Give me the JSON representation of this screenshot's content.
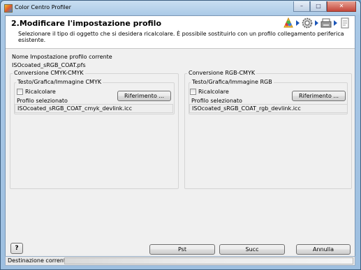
{
  "window": {
    "title": "Color Centro Profiler"
  },
  "header": {
    "title": "2.Modificare l'impostazione profilo",
    "subtitle": "Selezionare il tipo di oggetto che si desidera ricalcolare. È possibile sostituirlo con un profilo collegamento periferica esistente."
  },
  "current": {
    "label": "Nome Impostazione profilo corrente",
    "value": "ISOcoated_sRGB_COAT.pfs"
  },
  "cmyk": {
    "group_title": "Conversione CMYK-CMYK",
    "sub_title": "Testo/Grafica/Immagine CMYK",
    "recalc_label": "Ricalcolare",
    "reference_button": "Riferimento ...",
    "profile_label": "Profilo selezionato",
    "profile_value": "ISOcoated_sRGB_COAT_cmyk_devlink.icc"
  },
  "rgb": {
    "group_title": "Conversione RGB-CMYK",
    "sub_title": "Testo/Grafica/Immagine RGB",
    "recalc_label": "Ricalcolare",
    "reference_button": "Riferimento ...",
    "profile_label": "Profilo selezionato",
    "profile_value": "ISOcoated_sRGB_COAT_rgb_devlink.icc"
  },
  "footer": {
    "help_label": "?",
    "prev_button": "Pst",
    "next_button": "Succ",
    "cancel_button": "Annulla"
  },
  "status": {
    "label": "Destinazione corrente"
  },
  "icons": [
    "wizard-color-icon",
    "arrow-right-icon",
    "gear-icon",
    "arrow-right-icon",
    "printer-icon",
    "arrow-right-icon",
    "document-icon"
  ]
}
